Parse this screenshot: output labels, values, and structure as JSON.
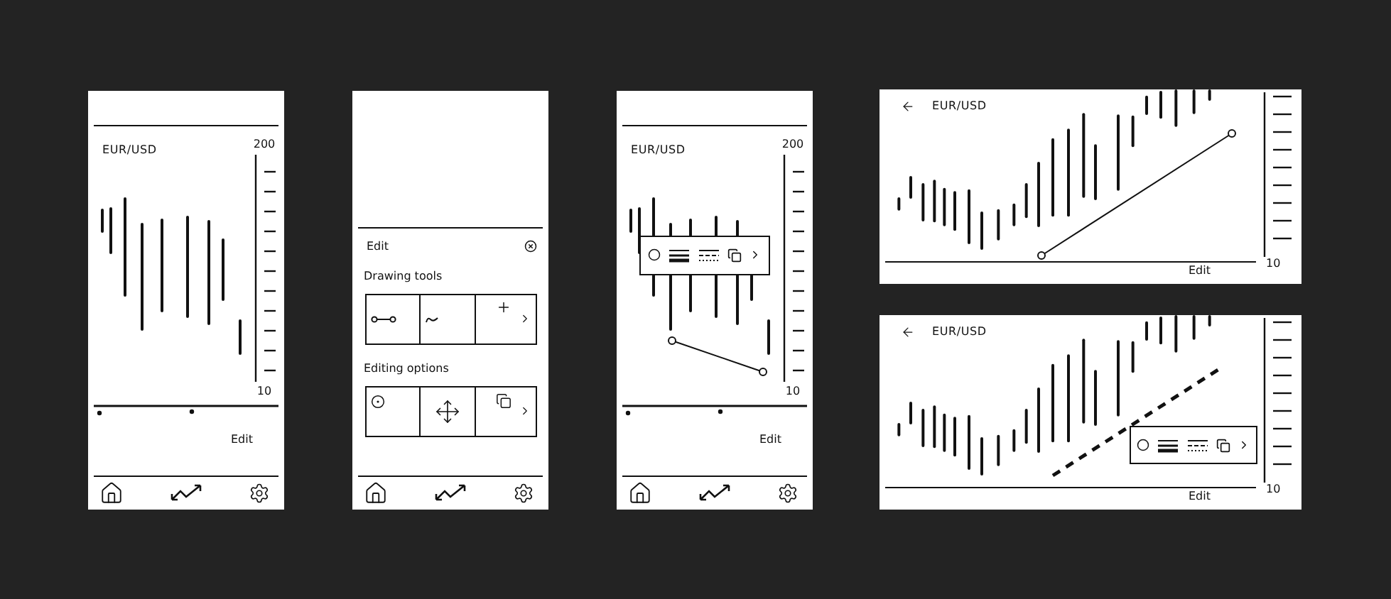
{
  "screens": [
    {
      "kind": "phone-chart",
      "title": "EUR/USD",
      "axis_max": "200",
      "axis_min": "10",
      "action": "Edit",
      "trend_line": false,
      "toolbar": false
    },
    {
      "kind": "phone-edit",
      "panel_title": "Edit",
      "sections": [
        {
          "heading": "Drawing tools"
        },
        {
          "heading": "Editing options"
        }
      ]
    },
    {
      "kind": "phone-chart",
      "title": "EUR/USD",
      "axis_max": "200",
      "axis_min": "10",
      "action": "Edit",
      "trend_line": true,
      "trend_dashed": false,
      "toolbar": true
    },
    {
      "kind": "wide-chart",
      "title": "EUR/USD",
      "axis_min": "10",
      "action": "Edit",
      "trend_line": true,
      "trend_dashed": false,
      "toolbar": false
    },
    {
      "kind": "wide-chart",
      "title": "EUR/USD",
      "axis_min": "10",
      "action": "Edit",
      "trend_line": true,
      "trend_dashed": true,
      "toolbar": true
    }
  ]
}
